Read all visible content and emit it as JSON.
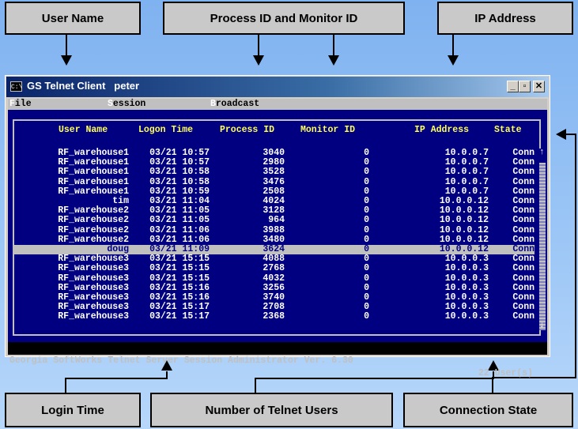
{
  "callouts": {
    "user_name": "User Name",
    "process_monitor": "Process ID and Monitor ID",
    "ip_address": "IP Address",
    "login_time": "Login Time",
    "num_users": "Number of Telnet Users",
    "conn_state": "Connection State"
  },
  "window": {
    "title": "GS Telnet Client   peter",
    "icon_glyph": "C:\\",
    "buttons": {
      "minimize": "_",
      "restore": "▫",
      "close": "✕"
    }
  },
  "menu": [
    {
      "hot": "F",
      "rest": "ile"
    },
    {
      "hot": "S",
      "rest": "ession"
    },
    {
      "hot": "B",
      "rest": "roadcast"
    }
  ],
  "table": {
    "headers": [
      "User Name",
      "Logon Time",
      "Process ID",
      "Monitor ID",
      "IP Address",
      "State"
    ],
    "rows": [
      [
        "RF_warehouse1",
        "03/21 10:57",
        "3040",
        "0",
        "10.0.0.7",
        "Conn"
      ],
      [
        "RF_warehouse1",
        "03/21 10:57",
        "2980",
        "0",
        "10.0.0.7",
        "Conn"
      ],
      [
        "RF_warehouse1",
        "03/21 10:58",
        "3528",
        "0",
        "10.0.0.7",
        "Conn"
      ],
      [
        "RF_warehouse1",
        "03/21 10:58",
        "3476",
        "0",
        "10.0.0.7",
        "Conn"
      ],
      [
        "RF_warehouse1",
        "03/21 10:59",
        "2508",
        "0",
        "10.0.0.7",
        "Conn"
      ],
      [
        "tim",
        "03/21 11:04",
        "4024",
        "0",
        "10.0.0.12",
        "Conn"
      ],
      [
        "RF_warehouse2",
        "03/21 11:05",
        "3128",
        "0",
        "10.0.0.12",
        "Conn"
      ],
      [
        "RF_warehouse2",
        "03/21 11:05",
        "964",
        "0",
        "10.0.0.12",
        "Conn"
      ],
      [
        "RF_warehouse2",
        "03/21 11:06",
        "3988",
        "0",
        "10.0.0.12",
        "Conn"
      ],
      [
        "RF_warehouse2",
        "03/21 11:06",
        "3480",
        "0",
        "10.0.0.12",
        "Conn"
      ],
      [
        "doug",
        "03/21 11:09",
        "3624",
        "0",
        "10.0.0.12",
        "Conn"
      ],
      [
        "RF_warehouse3",
        "03/21 15:15",
        "4088",
        "0",
        "10.0.0.3",
        "Conn"
      ],
      [
        "RF_warehouse3",
        "03/21 15:15",
        "2768",
        "0",
        "10.0.0.3",
        "Conn"
      ],
      [
        "RF_warehouse3",
        "03/21 15:15",
        "4032",
        "0",
        "10.0.0.3",
        "Conn"
      ],
      [
        "RF_warehouse3",
        "03/21 15:16",
        "3256",
        "0",
        "10.0.0.3",
        "Conn"
      ],
      [
        "RF_warehouse3",
        "03/21 15:16",
        "3740",
        "0",
        "10.0.0.3",
        "Conn"
      ],
      [
        "RF_warehouse3",
        "03/21 15:17",
        "2708",
        "0",
        "10.0.0.3",
        "Conn"
      ],
      [
        "RF_warehouse3",
        "03/21 15:17",
        "2368",
        "0",
        "10.0.0.3",
        "Conn"
      ]
    ],
    "selected_row": 10
  },
  "scrollbar": {
    "up": "↑",
    "down": "↓"
  },
  "status": {
    "left": "Georgia SoftWorks Telnet Server Session Administrator Ver. 6.30",
    "right": "22 User(s)"
  },
  "colors": {
    "panel_bg": "#000080",
    "header_text": "#ffff55",
    "row_text": "#ffffff",
    "selected_bg": "#c0c0c0"
  }
}
